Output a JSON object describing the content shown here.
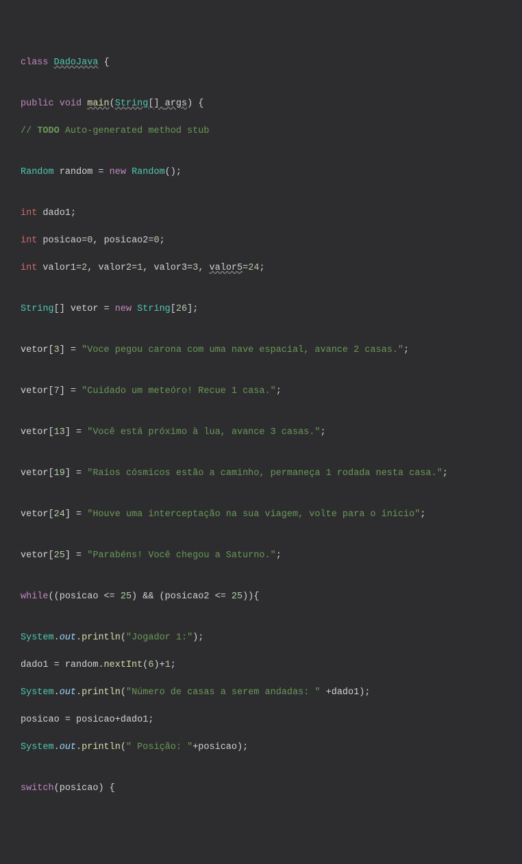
{
  "code": {
    "l1": {
      "kw_class": "class",
      "classname": "DadoJava",
      "brace": " {"
    },
    "l2": "",
    "l3": {
      "kw_public": "public",
      "kw_void": "void",
      "method": "main",
      "paren_open": "(",
      "type_string": "String",
      "brackets": "[] ",
      "param": "args",
      "paren_close": ")",
      "brace": " {"
    },
    "l4": {
      "comment_slash": "// ",
      "todo": "TODO",
      "comment_rest": " Auto-generated method stub"
    },
    "l5": "",
    "l6": {
      "type_random": "Random",
      "sp1": " ",
      "var_random": "random",
      "sp2": " = ",
      "kw_new": "new",
      "sp3": " ",
      "ctor": "Random",
      "tail": "();"
    },
    "l7": "",
    "l8": {
      "kw_int": "int",
      "sp": " ",
      "var": "dado1",
      "semi": ";"
    },
    "l9": {
      "kw_int": "int",
      "sp": " ",
      "v1": "posicao",
      "eq1": "=",
      "n1": "0",
      "comma": ", ",
      "v2": "posicao2",
      "eq2": "=",
      "n2": "0",
      "semi": ";"
    },
    "l10": {
      "kw_int": "int",
      "sp": " ",
      "v1": "valor1",
      "e1": "=",
      "n1": "2",
      "c1": ", ",
      "v2": "valor2",
      "e2": "=",
      "n2": "1",
      "c2": ", ",
      "v3": "valor3",
      "e3": "=",
      "n3": "3",
      "c3": ", ",
      "v5": "valor5",
      "e5": "=",
      "n5": "24",
      "semi": ";"
    },
    "l11": "",
    "l12": {
      "type_string": "String",
      "brackets": "[] ",
      "var": "vetor",
      "eq": " = ",
      "kw_new": "new",
      "sp": " ",
      "type_string2": "String",
      "bopen": "[",
      "num": "26",
      "bclose": "];"
    },
    "l13": "",
    "l14": {
      "var": "vetor",
      "bopen": "[",
      "idx": "3",
      "bclose": "] = ",
      "str": "\"Voce pegou carona com uma nave espacial, avance 2 casas.\"",
      "semi": ";"
    },
    "l15": "",
    "l16": {
      "var": "vetor",
      "bopen": "[",
      "idx": "7",
      "bclose": "] = ",
      "str": "\"Cuidado um meteóro! Recue 1 casa.\"",
      "semi": ";"
    },
    "l17": "",
    "l18": {
      "var": "vetor",
      "bopen": "[",
      "idx": "13",
      "bclose": "] = ",
      "str": "\"Você está próximo à lua, avance 3 casas.\"",
      "semi": ";"
    },
    "l19": "",
    "l20": {
      "var": "vetor",
      "bopen": "[",
      "idx": "19",
      "bclose": "] = ",
      "str": "\"Raios cósmicos estão a caminho, permaneça 1 rodada nesta casa.\"",
      "semi": ";"
    },
    "l21": "",
    "l22": {
      "var": "vetor",
      "bopen": "[",
      "idx": "24",
      "bclose": "] = ",
      "str": "\"Houve uma interceptação na sua viagem, volte para o inicio\"",
      "semi": ";"
    },
    "l23": "",
    "l24": {
      "var": "vetor",
      "bopen": "[",
      "idx": "25",
      "bclose": "] = ",
      "str": "\"Parabéns! Você chegou a Saturno.\"",
      "semi": ";"
    },
    "l25": "",
    "l26": {
      "kw_while": "while",
      "p1": "((",
      "v1": "posicao",
      "op1": " <= ",
      "n1": "25",
      "p2": ") && (",
      "v2": "posicao2",
      "op2": " <= ",
      "n2": "25",
      "p3": ")){"
    },
    "l27": "",
    "l28": {
      "sys": "System",
      "dot1": ".",
      "out": "out",
      "dot2": ".",
      "method": "println",
      "paren": "(",
      "str": "\"Jogador 1:\"",
      "end": ");"
    },
    "l29": {
      "v1": "dado1",
      "eq": " = ",
      "v2": "random",
      "dot": ".",
      "method": "nextInt",
      "paren": "(",
      "n": "6",
      "close": ")+",
      "n2": "1",
      "semi": ";"
    },
    "l30": {
      "sys": "System",
      "dot1": ".",
      "out": "out",
      "dot2": ".",
      "method": "println",
      "paren": "(",
      "str": "\"Número de casas a serem andadas: \"",
      "plus": " +",
      "v": "dado1",
      "end": ");"
    },
    "l31": {
      "v1": "posicao",
      "eq": " = ",
      "v2": "posicao",
      "plus": "+",
      "v3": "dado1",
      "semi": ";"
    },
    "l32": {
      "sys": "System",
      "dot1": ".",
      "out": "out",
      "dot2": ".",
      "method": "println",
      "paren": "(",
      "str": "\" Posição: \"",
      "plus": "+",
      "v": "posicao",
      "end": ");"
    },
    "l33": "",
    "l34": {
      "kw_switch": "switch",
      "paren": "(",
      "v": "posicao",
      "end": ") {"
    }
  }
}
